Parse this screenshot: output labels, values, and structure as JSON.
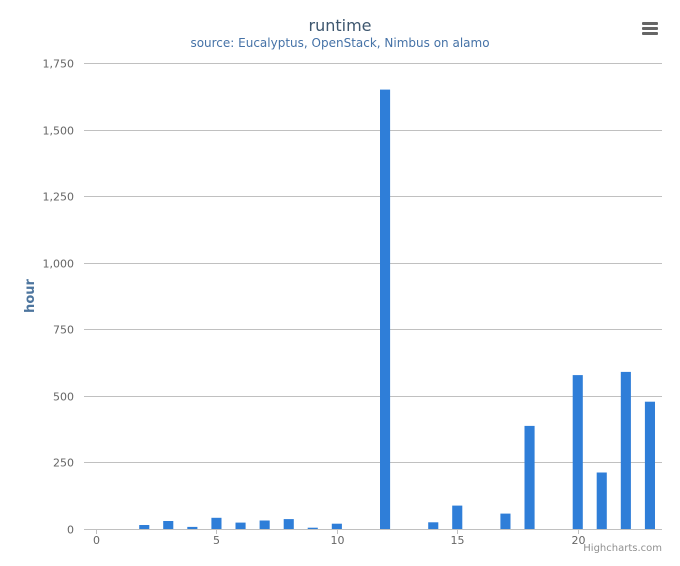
{
  "title": "runtime",
  "subtitle": "source: Eucalyptus, OpenStack, Nimbus on alamo",
  "credits": "Highcharts.com",
  "menu_icon": "hamburger-menu-icon",
  "colors": {
    "bar": "#2f7ed8",
    "grid": "#c0c0c0",
    "axis_title": "#4d759e",
    "tick_label": "#666666"
  },
  "chart_data": {
    "type": "bar",
    "title": "runtime",
    "subtitle": "source: Eucalyptus, OpenStack, Nimbus on alamo",
    "xlabel": "",
    "ylabel": "hour",
    "xlim": [
      -0.5,
      23.5
    ],
    "ylim": [
      0,
      1750
    ],
    "x_ticks": [
      0,
      5,
      10,
      15,
      20
    ],
    "x_tick_labels": [
      "0",
      "5",
      "10",
      "15",
      "20"
    ],
    "y_ticks": [
      0,
      250,
      500,
      750,
      1000,
      1250,
      1500,
      1750
    ],
    "y_tick_labels": [
      "0",
      "250",
      "500",
      "750",
      "1,000",
      "1,250",
      "1,500",
      "1,750"
    ],
    "grid": true,
    "legend": "none",
    "x": [
      0,
      1,
      2,
      3,
      4,
      5,
      6,
      7,
      8,
      9,
      10,
      11,
      12,
      13,
      14,
      15,
      16,
      17,
      18,
      19,
      20,
      21,
      22,
      23
    ],
    "values": [
      0,
      0,
      15,
      30,
      8,
      42,
      24,
      32,
      37,
      5,
      20,
      0,
      1650,
      0,
      25,
      88,
      0,
      58,
      387,
      0,
      578,
      212,
      590,
      478
    ]
  }
}
